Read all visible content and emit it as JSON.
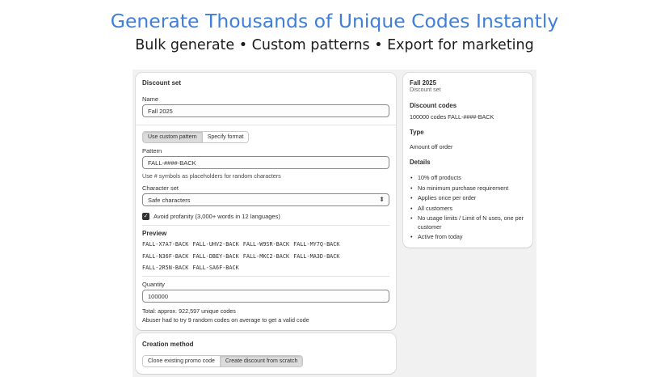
{
  "hero": {
    "title": "Generate Thousands of Unique Codes Instantly",
    "subtitle": "Bulk generate • Custom patterns • Export for marketing"
  },
  "form": {
    "section_title": "Discount set",
    "name_label": "Name",
    "name_value": "Fall 2025",
    "mode_tabs": [
      "Use custom pattern",
      "Specify format"
    ],
    "active_mode": "Use custom pattern",
    "pattern_label": "Pattern",
    "pattern_value": "FALL-####-BACK",
    "pattern_help": "Use # symbols as placeholders for random characters",
    "charset_label": "Character set",
    "charset_value": "Safe characters",
    "charset_chevron_icon": "up-down-chevron-icon",
    "profanity_label": "Avoid profanity (3,000+ words in 12 languages)",
    "profanity_checked": true,
    "preview_title": "Preview",
    "preview_rows": [
      "FALL-X7A7-BACK  FALL-UHV2-BACK  FALL-W9SR-BACK  FALL-MY7Q-BACK",
      "FALL-N36F-BACK  FALL-DBEY-BACK  FALL-MKC2-BACK  FALL-MA3D-BACK",
      "FALL-2R5N-BACK  FALL-SA6F-BACK"
    ],
    "quantity_label": "Quantity",
    "quantity_value": "100000",
    "total_text": "Total: approx. 922,597 unique codes",
    "abuser_text": "Abuser had to try 9 random codes on average to get a valid code"
  },
  "method": {
    "title": "Creation method",
    "options": [
      "Clone existing promo code",
      "Create discount from scratch"
    ],
    "active": "Create discount from scratch"
  },
  "summary": {
    "title": "Fall 2025",
    "subtitle": "Discount set",
    "codes_heading": "Discount codes",
    "codes_text": "100000 codes FALL-####-BACK",
    "type_heading": "Type",
    "type_text": "Amount off order",
    "details_heading": "Details",
    "details": [
      "10% off products",
      "No minimum purchase requirement",
      "Applies once per order",
      "All customers",
      "No usage limits / Limit of N uses, one per customer",
      "Active from today"
    ]
  }
}
